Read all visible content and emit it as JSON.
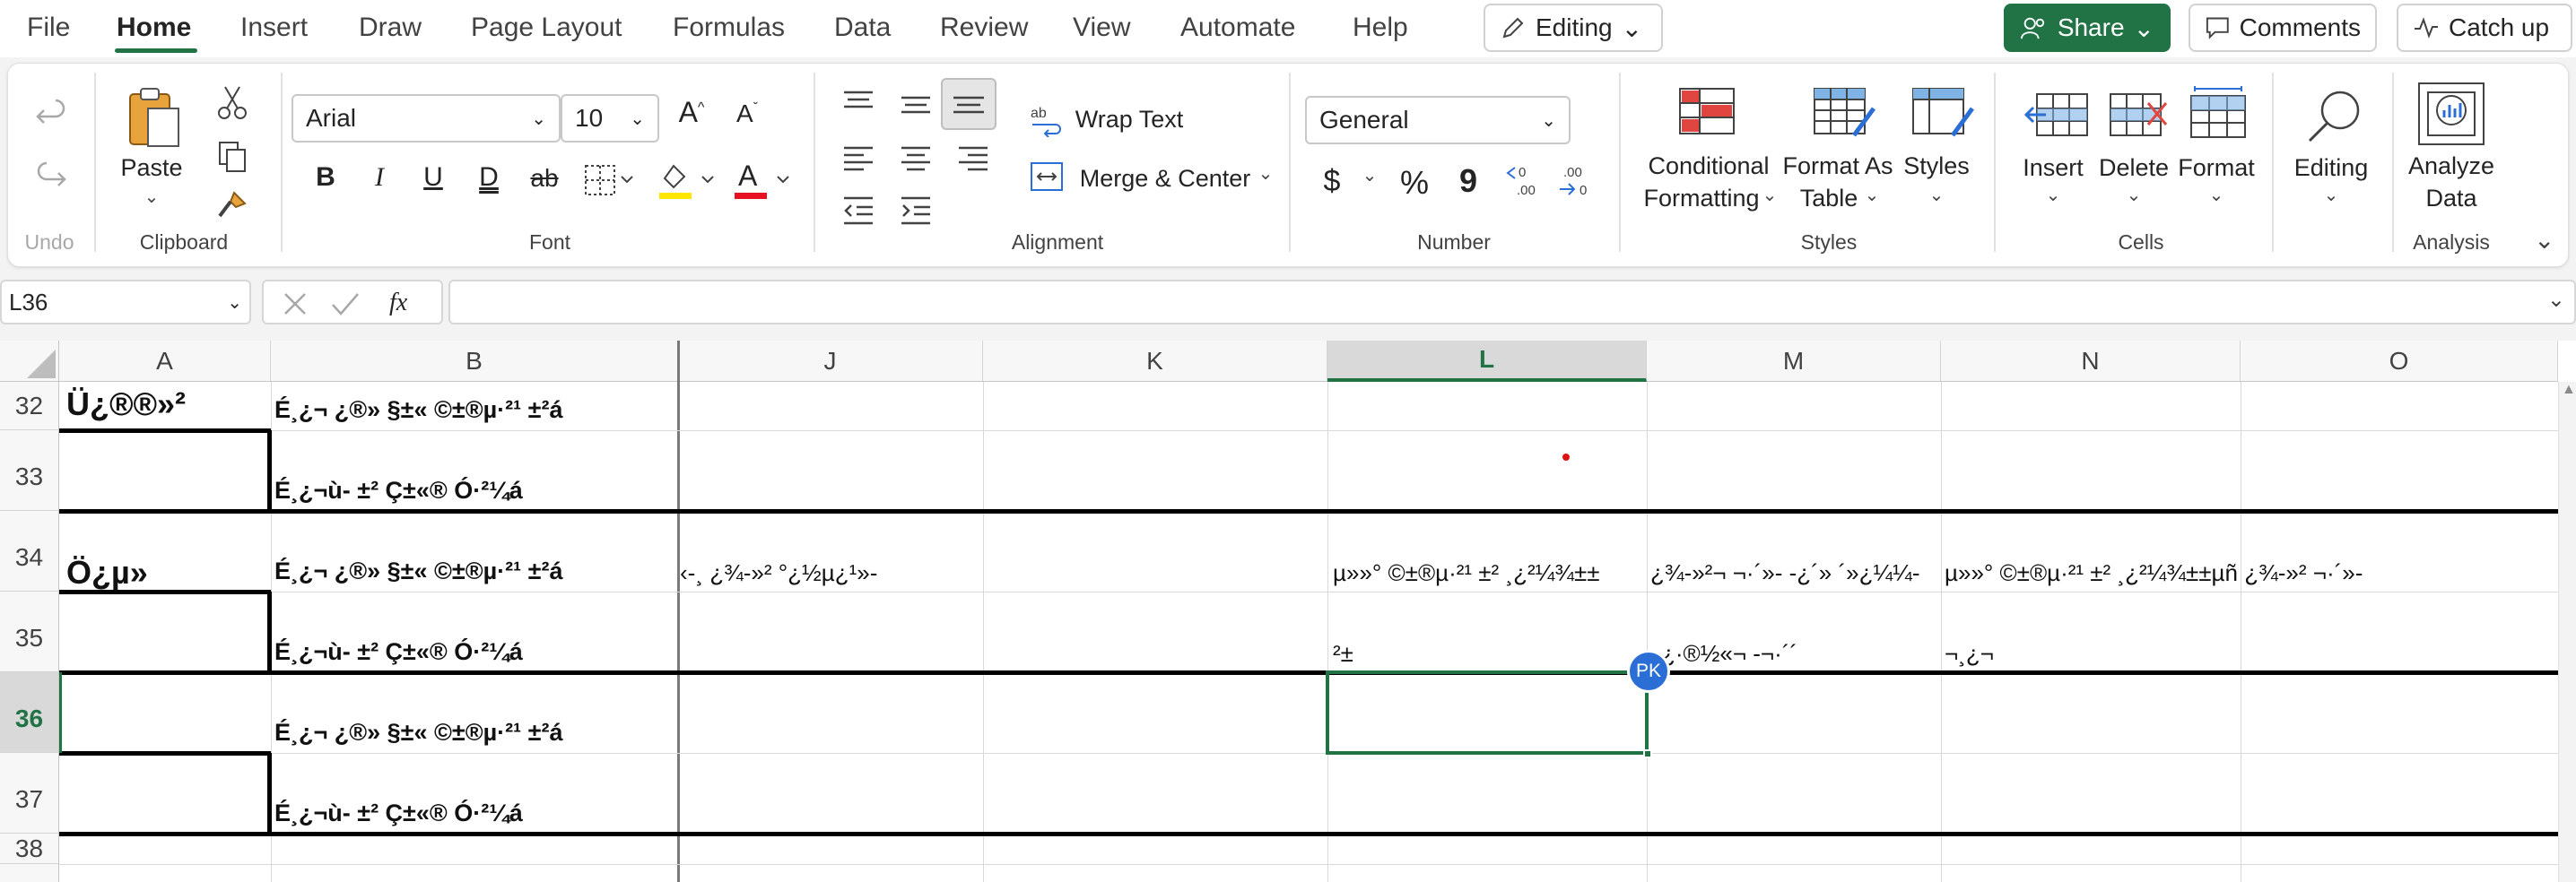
{
  "menu": {
    "tabs": [
      "File",
      "Home",
      "Insert",
      "Draw",
      "Page Layout",
      "Formulas",
      "Data",
      "Review",
      "View",
      "Automate",
      "Help"
    ],
    "editing_mode": "Editing",
    "share": "Share",
    "comments": "Comments",
    "catch_up": "Catch up"
  },
  "ribbon": {
    "undo": {
      "label": "Undo"
    },
    "clipboard": {
      "paste": "Paste",
      "group": "Clipboard"
    },
    "font": {
      "name": "Arial",
      "size": "10",
      "group": "Font",
      "bold": "B",
      "italic": "I",
      "underline": "U",
      "double_underline": "D",
      "strike": "ab"
    },
    "alignment": {
      "wrap": "Wrap Text",
      "merge": "Merge & Center",
      "group": "Alignment"
    },
    "number": {
      "format": "General",
      "currency": "$",
      "percent": "%",
      "comma": "9",
      "group": "Number"
    },
    "styles": {
      "conditional_1": "Conditional",
      "conditional_2": "Formatting",
      "format_table_1": "Format As",
      "format_table_2": "Table",
      "cell_styles": "Styles",
      "group": "Styles"
    },
    "cells": {
      "insert": "Insert",
      "delete": "Delete",
      "format": "Format",
      "group": "Cells"
    },
    "editing": {
      "label": "Editing"
    },
    "analysis": {
      "label_1": "Analyze",
      "label_2": "Data",
      "group": "Analysis"
    }
  },
  "formula_bar": {
    "name_box": "L36",
    "fx": "fx",
    "formula": ""
  },
  "columns": [
    "A",
    "B",
    "J",
    "K",
    "L",
    "M",
    "N",
    "O"
  ],
  "selected_column": "L",
  "rows": [
    "32",
    "33",
    "34",
    "35",
    "36",
    "37",
    "38"
  ],
  "selected_row": "36",
  "cells": {
    "A32": "Ü¿®®»²",
    "A34": "Ö¿µ»",
    "B32": "É¸¿¬ ¿®» §±« ©±®µ·²¹ ±²á",
    "B33": "É¸¿¬ù- ±² Ç±«® Ó·²¼á",
    "B34": "É¸¿¬ ¿®» §±« ©±®µ·²¹ ±²á",
    "B35": "É¸¿¬ù- ±² Ç±«® Ó·²¼á",
    "B36": "É¸¿¬ ¿®» §±« ©±®µ·²¹ ±²á",
    "B37": "É¸¿¬ù- ±² Ç±«® Ó·²¼á",
    "J34": "‹-¸ ¿¾-»² °¿½µ¿¹»-",
    "L34": "µ»»° ©±®µ·²¹ ±² ¸¿²¼¾±±",
    "M34": "¿¾-»²¬ ¬·´»- -¿´» ´»¿¼¼-",
    "N34": "µ»»° ©±®µ·²¹ ±² ¸¿²¼¾±±µñ ¿¾-»² ¬·´»-",
    "L35": "²±",
    "M35": "¿·®½«¬ -¬·´´",
    "N35": "¬¸¿¬"
  },
  "presence": {
    "initials": "PK",
    "color": "#2b6fd6"
  },
  "colors": {
    "accent": "#217346",
    "font_color_bar": "#e81123",
    "highlight_bar": "#ffe600"
  }
}
